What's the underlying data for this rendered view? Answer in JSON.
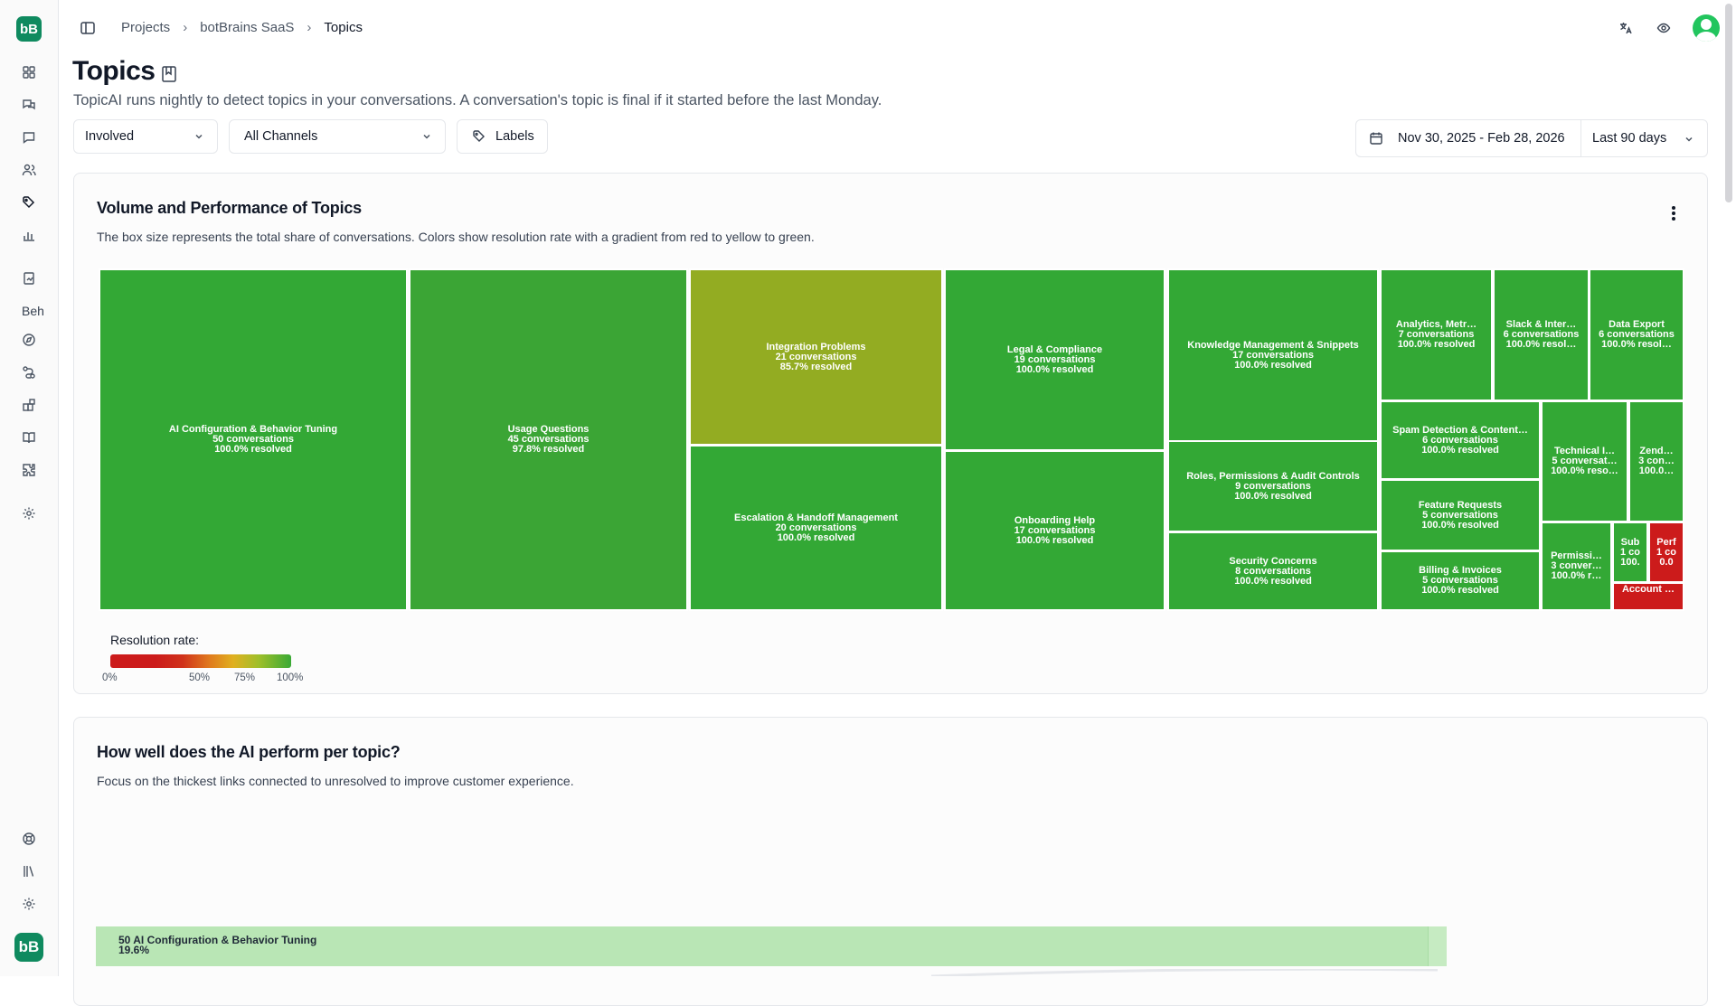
{
  "sidebar": {
    "logo": "bB",
    "section_label": "Beh",
    "icons": [
      "dashboard-icon",
      "conversations-icon",
      "chat-icon",
      "users-icon",
      "tags-icon",
      "analytics-icon",
      "report-icon",
      "compass-icon",
      "workflow-icon",
      "integrations-icon",
      "book-icon",
      "plugin-icon",
      "settings-icon",
      "help-icon",
      "library-icon",
      "settings-icon"
    ]
  },
  "breadcrumb": {
    "items": [
      "Projects",
      "botBrains SaaS",
      "Topics"
    ]
  },
  "header": {
    "title": "Topics",
    "subtitle": "TopicAI runs nightly to detect topics in your conversations. A conversation's topic is final if it started before the last Monday."
  },
  "filters": {
    "involvement": "Involved",
    "channels": "All Channels",
    "labels": "Labels",
    "date_range": "Nov 30, 2025 - Feb 28, 2026",
    "preset": "Last 90 days"
  },
  "volume_card": {
    "title": "Volume and Performance of Topics",
    "description": "The box size represents the total share of conversations. Colors show resolution rate with a gradient from red to yellow to green.",
    "legend_label": "Resolution rate:",
    "legend_ticks": [
      "0%",
      "50%",
      "75%",
      "100%"
    ]
  },
  "chart_data": {
    "type": "treemap",
    "color_scale": {
      "low": "#cc1b1b",
      "mid": "#e0b020",
      "high": "#3aa935"
    },
    "tiles": [
      {
        "name": "AI Configuration & Behavior Tuning",
        "label": "AI Configuration & Behavior Tuning",
        "count": "50 conversations",
        "rate": "100.0% resolved",
        "color": "#33a835"
      },
      {
        "name": "Usage Questions",
        "label": "Usage Questions",
        "count": "45 conversations",
        "rate": "97.8% resolved",
        "color": "#3ba535"
      },
      {
        "name": "Integration Problems",
        "label": "Integration Problems",
        "count": "21 conversations",
        "rate": "85.7% resolved",
        "color": "#93ac22"
      },
      {
        "name": "Escalation & Handoff Management",
        "label": "Escalation & Handoff Management",
        "count": "20 conversations",
        "rate": "100.0% resolved",
        "color": "#33a835"
      },
      {
        "name": "Legal & Compliance",
        "label": "Legal & Compliance",
        "count": "19 conversations",
        "rate": "100.0% resolved",
        "color": "#33a835"
      },
      {
        "name": "Onboarding Help",
        "label": "Onboarding Help",
        "count": "17 conversations",
        "rate": "100.0% resolved",
        "color": "#33a835"
      },
      {
        "name": "Knowledge Management & Snippets",
        "label": "Knowledge Management & Snippets",
        "count": "17 conversations",
        "rate": "100.0% resolved",
        "color": "#33a835"
      },
      {
        "name": "Roles, Permissions & Audit Controls",
        "label": "Roles, Permissions & Audit Controls",
        "count": "9 conversations",
        "rate": "100.0% resolved",
        "color": "#33a835"
      },
      {
        "name": "Security Concerns",
        "label": "Security Concerns",
        "count": "8 conversations",
        "rate": "100.0% resolved",
        "color": "#33a835"
      },
      {
        "name": "Analytics, Metrics",
        "label": "Analytics, Metr…",
        "count": "7 conversations",
        "rate": "100.0% resolved",
        "color": "#33a835"
      },
      {
        "name": "Slack & Integrations",
        "label": "Slack & Inter…",
        "count": "6 conversations",
        "rate": "100.0% resol…",
        "color": "#33a835"
      },
      {
        "name": "Data Export",
        "label": "Data Export",
        "count": "6 conversations",
        "rate": "100.0% resol…",
        "color": "#33a835"
      },
      {
        "name": "Spam Detection & Content",
        "label": "Spam Detection & Content…",
        "count": "6 conversations",
        "rate": "100.0% resolved",
        "color": "#33a835"
      },
      {
        "name": "Technical Issues",
        "label": "Technical I…",
        "count": "5 conversat…",
        "rate": "100.0% reso…",
        "color": "#33a835"
      },
      {
        "name": "Zendesk",
        "label": "Zend…",
        "count": "3 con…",
        "rate": "100.0…",
        "color": "#33a835"
      },
      {
        "name": "Feature Requests",
        "label": "Feature Requests",
        "count": "5 conversations",
        "rate": "100.0% resolved",
        "color": "#33a835"
      },
      {
        "name": "Billing & Invoices",
        "label": "Billing & Invoices",
        "count": "5 conversations",
        "rate": "100.0% resolved",
        "color": "#33a835"
      },
      {
        "name": "Permissions",
        "label": "Permissi…",
        "count": "3 conver…",
        "rate": "100.0% r…",
        "color": "#33a835"
      },
      {
        "name": "Sub",
        "label": "Sub",
        "count": "1 co",
        "rate": "100.",
        "color": "#33a835"
      },
      {
        "name": "Perf",
        "label": "Perf",
        "count": "1 co",
        "rate": "0.0",
        "color": "#cc1b1b"
      },
      {
        "name": "Account",
        "label": "Account …",
        "count": "",
        "rate": "",
        "color": "#cc1b1b"
      }
    ]
  },
  "performance_card": {
    "title": "How well does the AI perform per topic?",
    "description": "Focus on the thickest links connected to unresolved to improve customer experience.",
    "sankey_nodes": [
      {
        "label": "50 AI Configuration & Behavior Tuning",
        "share": "19.6%",
        "color": "#b9e6b5"
      }
    ]
  }
}
